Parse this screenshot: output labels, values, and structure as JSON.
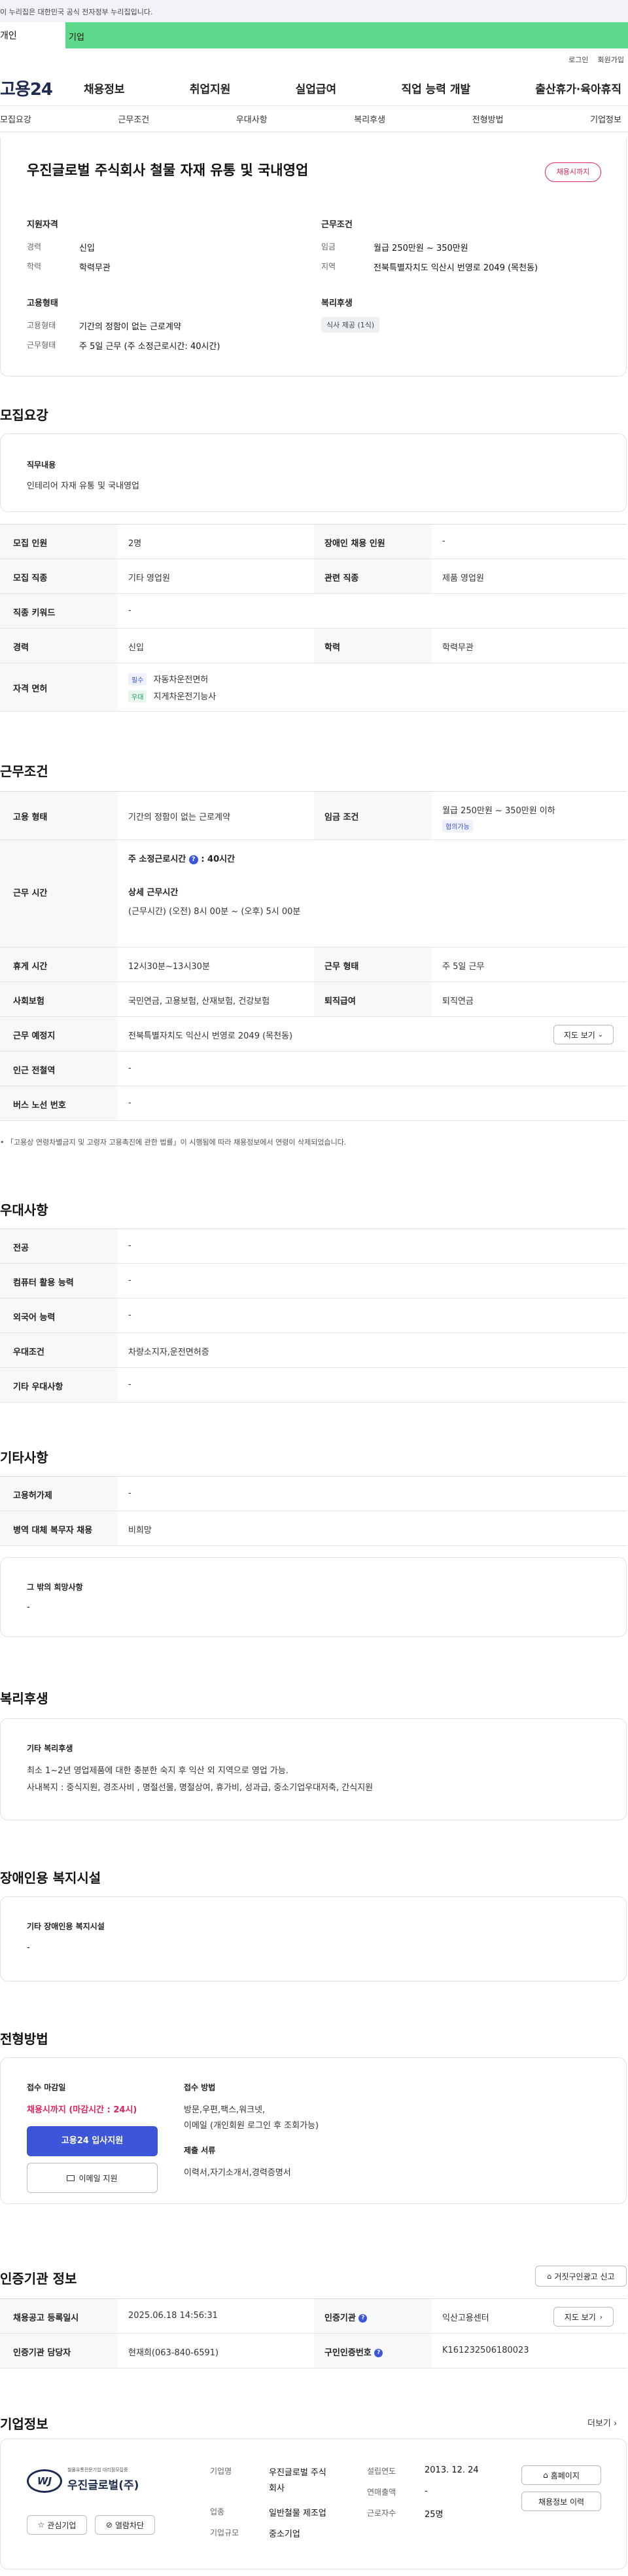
{
  "top": {
    "notice": "이 누리집은 대한민국 공식 전자정부 누리집입니다.",
    "personal_tab": "개인",
    "biz_tab": "기업"
  },
  "util": {
    "login": "로그인",
    "join": "회원가입"
  },
  "header": {
    "logo": "고용24",
    "nav": [
      "채용정보",
      "취업지원",
      "실업급여",
      "직업 능력 개발",
      "출산휴가·육아휴직"
    ]
  },
  "subnav": [
    "모집요강",
    "근무조건",
    "우대사항",
    "복리후생",
    "전형방법",
    "기업정보"
  ],
  "job": {
    "title": "우진글로벌 주식회사 철물 자재 유통 및 국내영업",
    "status": "채용시까지",
    "qual_title": "지원자격",
    "career_k": "경력",
    "career_v": "신입",
    "edu_k": "학력",
    "edu_v": "학력무관",
    "emp_title": "고용형태",
    "emp_k": "고용형태",
    "emp_v": "기간의 정함이 없는 근로계약",
    "time_k": "근무형태",
    "time_v": "주 5일 근무 (주 소정근로시간: 40시간)",
    "cond_title": "근무조건",
    "wage_k": "임금",
    "wage_v": "월급 250만원 ~ 350만원",
    "region_k": "지역",
    "region_v": "전북특별자치도 익산시 번영로 2049 (목천동)",
    "welfare_title": "복리후생",
    "welfare_chip": "식사 제공 (1식)"
  },
  "recruit": {
    "heading": "모집요강",
    "duty_label": "직무내용",
    "duty_value": "인테리어 자재 유통 및 국내영업",
    "rows": {
      "count_k": "모집 인원",
      "count_v": "2명",
      "disabled_k": "장애인 채용 인원",
      "disabled_v": "-",
      "job_k": "모집 직종",
      "job_v": "기타 영업원",
      "related_k": "관련 직종",
      "related_v": "제품 영업원",
      "keyword_k": "직종 키워드",
      "keyword_v": "-",
      "career_k": "경력",
      "career_v": "신입",
      "edu_k": "학력",
      "edu_v": "학력무관",
      "license_k": "자격 면허",
      "lic1_tag": "필수",
      "lic1": "자동차운전면허",
      "lic2_tag": "우대",
      "lic2": "지게차운전기능사"
    }
  },
  "work": {
    "heading": "근무조건",
    "type_k": "고용 형태",
    "type_v": "기간의 정함이 없는 근로계약",
    "wage_k": "임금 조건",
    "wage_v": "월급 250만원 ~ 350만원 이하",
    "wage_tag": "협의가능",
    "hours_k": "근무 시간",
    "hours_line1": "주 소정근로시간",
    "hours_line1b": ": 40시간",
    "hours_line2": "상세 근무시간",
    "hours_line3": "(근무시간) (오전) 8시 00분 ~ (오후) 5시 00분",
    "break_k": "휴게 시간",
    "break_v": "12시30분~13시30분",
    "shift_k": "근무 형태",
    "shift_v": "주 5일 근무",
    "insure_k": "사회보험",
    "insure_v": "국민연금, 고용보험, 산재보험, 건강보험",
    "retire_k": "퇴직급여",
    "retire_v": "퇴직연금",
    "place_k": "근무 예정지",
    "place_v": "전북특별자치도 익산시 번영로 2049 (목천동)",
    "map_btn": "지도 보기",
    "station_k": "인근 전철역",
    "station_v": "-",
    "bus_k": "버스 노선 번호",
    "bus_v": "-",
    "footnote": "「고용상 연령차별금지 및 고령자 고용촉진에 관한 법률」이 시행됨에 따라 채용정보에서 연령이 삭제되었습니다."
  },
  "pref": {
    "heading": "우대사항",
    "major_k": "전공",
    "major_v": "-",
    "pc_k": "컴퓨터 활용 능력",
    "pc_v": "-",
    "lang_k": "외국어 능력",
    "lang_v": "-",
    "cond_k": "우대조건",
    "cond_v": "차량소지자,운전면허증",
    "other_k": "기타 우대사항",
    "other_v": "-"
  },
  "etc": {
    "heading": "기타사항",
    "emp_k": "고용허가제",
    "emp_v": "-",
    "mil_k": "병역 대체 복무자 채용",
    "mil_v": "비희망",
    "wish_label": "그 밖의 희망사항",
    "wish_v": "-"
  },
  "welfare": {
    "heading": "복리후생",
    "label": "기타 복리후생",
    "line1": "최소 1~2년 영업제품에 대한 충분한 숙지 후 익산 외 지역으로 영업 가능.",
    "line2": "사내복지 : 중식지원, 경조사비 , 명절선물, 명절상여, 휴가비, 성과급, 중소기업우대저축, 간식지원"
  },
  "disabled": {
    "heading": "장애인용 복지시설",
    "label": "기타 장애인용 복지시설",
    "value": "-"
  },
  "apply": {
    "heading": "전형방법",
    "deadline_label": "접수 마감일",
    "deadline_v": "채용시까지 (마감시간 : 24시)",
    "apply_btn": "고용24 입사지원",
    "email_btn": "이메일 지원",
    "method_label": "접수 방법",
    "method_v1": "방문,우편,팩스,워크넷,",
    "method_v2": "이메일 (개인회원 로그인 후 조회가능)",
    "docs_label": "제출 서류",
    "docs_v": "이력서,자기소개서,경력증명서"
  },
  "agency": {
    "heading": "인증기관 정보",
    "report_btn": "거짓구인광고 신고",
    "reg_k": "채용공고 등록일시",
    "reg_v": "2025.06.18 14:56:31",
    "org_k": "인증기관",
    "org_v": "익산고용센터",
    "map_btn": "지도 보기",
    "mgr_k": "인증기관 담당자",
    "mgr_v": "현재희(063-840-6591)",
    "num_k": "구인인증번호",
    "num_v": "K161232506180023"
  },
  "company": {
    "heading": "기업정보",
    "more": "더보기",
    "logo_small": "철물유통전문기업 대리점모집중",
    "logo_name": "우진글로벌(주)",
    "interest_btn": "관심기업",
    "block_btn": "열람차단",
    "name_k": "기업명",
    "name_v1": "우진글로벌 주식",
    "name_v2": "회사",
    "ind_k": "업종",
    "ind_v": "일반철물 제조업",
    "size_k": "기업규모",
    "size_v": "중소기업",
    "est_k": "설립연도",
    "est_v": "2013. 12. 24",
    "rev_k": "연매출액",
    "rev_v": "-",
    "staff_k": "근로자수",
    "staff_v": "25명",
    "home_btn": "홈페이지",
    "history_btn": "채용정보 이력"
  },
  "colors": {
    "accent": "#3c55d9",
    "red": "#e0245e",
    "green": "#5ed88a",
    "navy": "#1d2c4f"
  }
}
